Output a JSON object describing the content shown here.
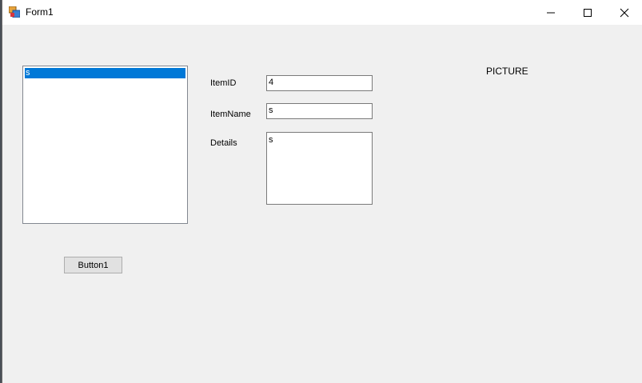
{
  "window": {
    "title": "Form1"
  },
  "listbox": {
    "items": [
      "s"
    ],
    "selected_index": 0
  },
  "form": {
    "item_id_label": "ItemID",
    "item_id_value": "4",
    "item_name_label": "ItemName",
    "item_name_value": "s",
    "details_label": "Details",
    "details_value": "s",
    "picture_label": "PICTURE"
  },
  "button1": {
    "label": "Button1"
  },
  "colors": {
    "selection": "#0078d7",
    "form_background": "#f0f0f0",
    "titlebar": "#ffffff"
  }
}
